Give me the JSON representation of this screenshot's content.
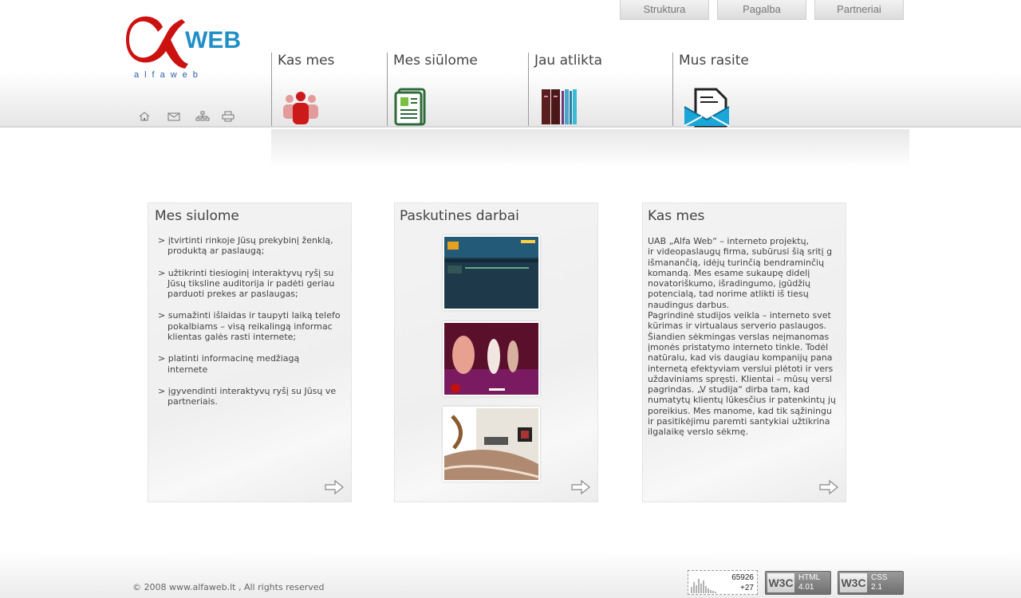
{
  "top_links": [
    "Struktura",
    "Pagalba",
    "Partneriai"
  ],
  "logo": {
    "brand": "WEB",
    "sub": "alfaweb"
  },
  "utility_icons": [
    "home-icon",
    "mail-icon",
    "sitemap-icon",
    "print-icon"
  ],
  "nav": [
    {
      "label": "Kas mes",
      "icon": "people-icon"
    },
    {
      "label": "Mes siūlome",
      "icon": "document-icon"
    },
    {
      "label": "Jau atlikta",
      "icon": "books-icon"
    },
    {
      "label": "Mus rasite",
      "icon": "envelope-icon"
    }
  ],
  "boxes": {
    "offer": {
      "title": "Mes siulome",
      "items": [
        "įtvirtinti rinkoje Jūsų prekybinį ženklą,\nproduktą ar paslaugą;",
        "užtikrinti tiesioginį interaktyvų ryšį su\nJūsų tiksline auditorija ir padėti geriau\nparduoti prekes ar paslaugas;",
        "sumažinti išlaidas ir taupyti laiką telefo\npokalbiams – visą reikalingą informac\nklientas galės rasti internete;",
        "platinti informacinę medžiagą internete",
        "įgyvendinti interaktyvų ryšį su Jūsų ve\npartneriais."
      ]
    },
    "works": {
      "title": "Paskutines darbai"
    },
    "about": {
      "title": "Kas mes",
      "text": "UAB „Alfa Web“ – interneto projektų,\nir videopaslaugų firma, subūrusi šią sritį g\nišmanančią, idėjų turinčią bendraminčių\nkomandą. Mes esame sukaupę didelį\nnovatoriškumo, išradingumo, įgūdžių\npotencialą, tad norime atlikti iš tiesų\nnaudingus darbus.\nPagrindinė studijos veikla – interneto svet\nkūrimas ir virtualaus serverio paslaugos.\nŠiandien sėkmingas verslas neįmanomas\nįmonės pristatymo interneto tinkle. Todėl\nnatūralu, kad vis daugiau kompanijų pana\ninternetą efektyviam verslui plėtoti ir vers\nuždaviniams spręsti. Klientai – mūsų versl\npagrindas. „V studija“ dirba tam, kad\nnumatytų klientų lūkesčius ir patenkintų jų\nporeikius. Mes manome, kad tik sąžiningu\nir pasitikėjimu paremti santykiai užtikrina\nilgalaikę verslo sėkmę."
    }
  },
  "footer": {
    "copyright": "© 2008 www.alfaweb.lt , All rights reserved",
    "counter_total": "65926",
    "counter_today": "+27",
    "badge_html": {
      "left": "W3C",
      "line1": "HTML",
      "line2": "4.01"
    },
    "badge_css": {
      "left": "W3C",
      "line1": "CSS",
      "line2": "2.1"
    }
  },
  "colors": {
    "brand_red": "#cc1111",
    "brand_blue": "#1f8fc6"
  }
}
